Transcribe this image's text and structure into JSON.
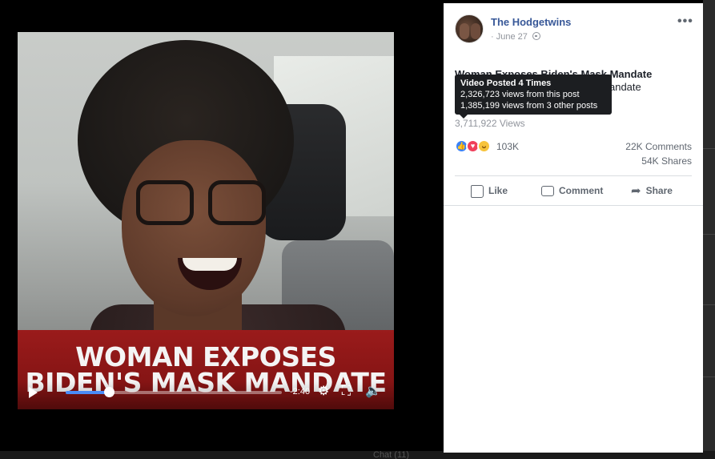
{
  "video": {
    "headline_line1": "WOMAN EXPOSES",
    "headline_line2": "BIDEN'S MASK MANDATE",
    "time_remaining": "-2:40",
    "progress": 0.2
  },
  "post": {
    "page_name": "The Hodgetwins",
    "date": "June 27",
    "date_prefix": "·",
    "more_label": "•••",
    "title_line1": "Woman Exposes Biden's Mask Mandate",
    "title_line2": "Woman Exposes Biden's Mask Mandate",
    "views": "3,711,922 Views",
    "reaction_count": "103K",
    "comments": "22K Comments",
    "shares": "54K Shares",
    "actions": {
      "like": "Like",
      "comment": "Comment",
      "share": "Share"
    }
  },
  "tooltip": {
    "heading": "Video Posted 4 Times",
    "line1": "2,326,723 views from this post",
    "line2": "1,385,199 views from 3 other posts"
  },
  "footer": {
    "chat": "Chat (11)"
  },
  "colors": {
    "link": "#385898",
    "tooltip_bg": "#1c1e21",
    "progress": "#4a8cf7",
    "banner": "#8b1515"
  }
}
